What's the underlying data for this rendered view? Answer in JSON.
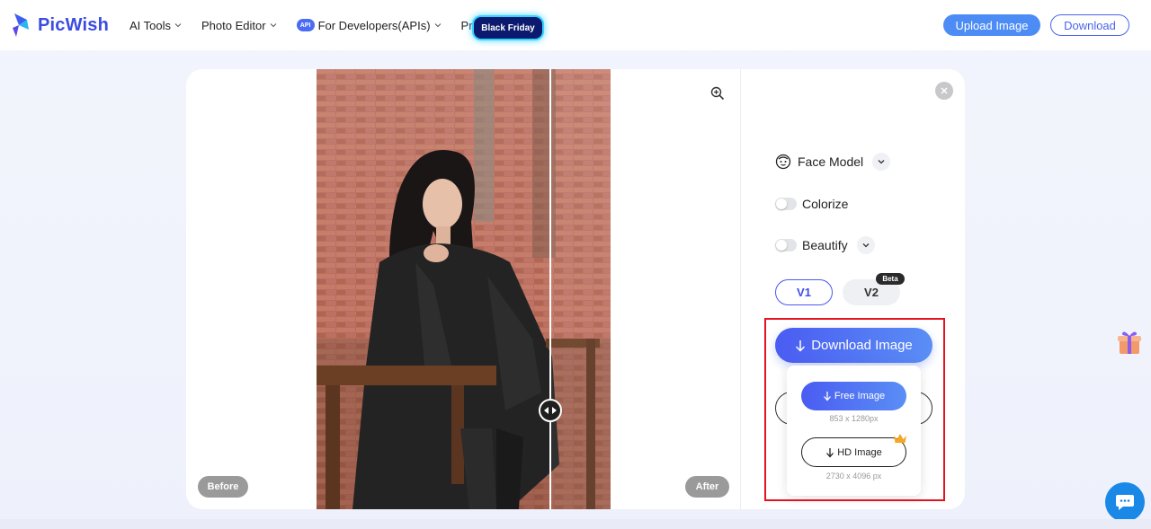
{
  "brand": {
    "name": "PicWish",
    "accent": "#3b4ce0"
  },
  "nav": {
    "items": [
      {
        "label": "AI Tools",
        "has_dropdown": true
      },
      {
        "label": "Photo Editor",
        "has_dropdown": true
      },
      {
        "label": "For Developers(APIs)",
        "has_dropdown": true,
        "badge": "API"
      },
      {
        "label": "Pricing",
        "has_dropdown": false
      }
    ],
    "promo_badge": "Black Friday"
  },
  "header": {
    "upload_label": "Upload Image",
    "download_label": "Download"
  },
  "preview": {
    "before_label": "Before",
    "after_label": "After"
  },
  "panel": {
    "face_model_label": "Face Model",
    "colorize_label": "Colorize",
    "colorize_on": false,
    "beautify_label": "Beautify",
    "beautify_on": false,
    "versions": [
      {
        "label": "V1",
        "selected": true
      },
      {
        "label": "V2",
        "selected": false,
        "badge": "Beta"
      }
    ],
    "download_image_label": "Download Image"
  },
  "download_menu": {
    "free_label": "Free Image",
    "free_size": "853 x 1280px",
    "hd_label": "HD Image",
    "hd_size": "2730 x 4096 px"
  },
  "colors": {
    "primary_blue": "#4a5cf2",
    "highlight_red": "#e5121f",
    "chat_blue": "#1a88e6"
  }
}
